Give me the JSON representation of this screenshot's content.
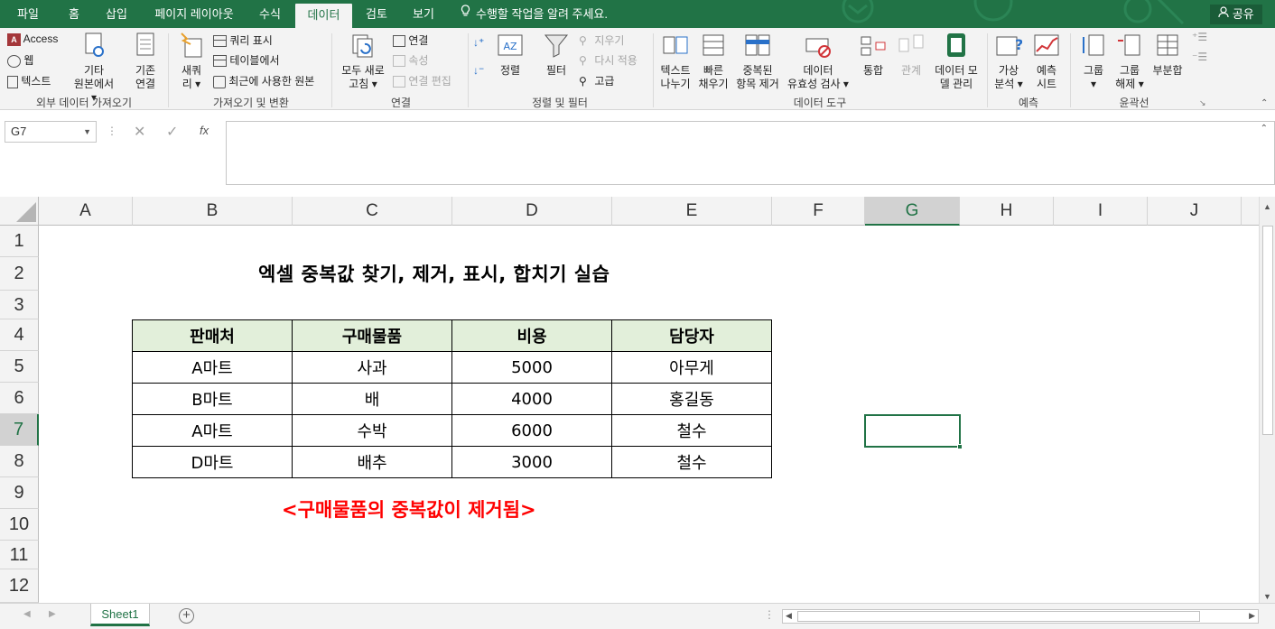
{
  "tabs": [
    "파일",
    "홈",
    "삽입",
    "페이지 레이아웃",
    "수식",
    "데이터",
    "검토",
    "보기"
  ],
  "active_tab": "데이터",
  "tell_me": "수행할 작업을 알려 주세요.",
  "share": "공유",
  "ribbon": {
    "ext_data": {
      "access": "Access",
      "web": "웹",
      "text": "텍스트",
      "other_line1": "기타",
      "other_line2": "원본에서",
      "existing_line1": "기존",
      "existing_line2": "연결",
      "label": "외부 데이터 가져오기"
    },
    "get_transform": {
      "new_query_line1": "새쿼",
      "new_query_line2": "리",
      "show_queries": "쿼리 표시",
      "from_table": "테이블에서",
      "recent_sources": "최근에 사용한 원본",
      "label": "가져오기 및 변환"
    },
    "connections": {
      "refresh_line1": "모두 새로",
      "refresh_line2": "고침",
      "connections": "연결",
      "properties": "속성",
      "edit_links": "연결 편집",
      "label": "연결"
    },
    "sort_filter": {
      "sort": "정렬",
      "filter": "필터",
      "clear": "지우기",
      "reapply": "다시 적용",
      "advanced": "고급",
      "label": "정렬 및 필터"
    },
    "data_tools": {
      "text_to_col_line1": "텍스트",
      "text_to_col_line2": "나누기",
      "flash_fill_line1": "빠른",
      "flash_fill_line2": "채우기",
      "remove_dup_line1": "중복된",
      "remove_dup_line2": "항목 제거",
      "validation_line1": "데이터",
      "validation_line2": "유효성 검사",
      "consolidate": "통합",
      "relationships": "관계",
      "data_model_line1": "데이터 모",
      "data_model_line2": "델 관리",
      "label": "데이터 도구"
    },
    "forecast": {
      "whatif_line1": "가상",
      "whatif_line2": "분석",
      "sheet_line1": "예측",
      "sheet_line2": "시트",
      "label": "예측"
    },
    "outline": {
      "group": "그룹",
      "ungroup_line1": "그룹",
      "ungroup_line2": "해제",
      "subtotal": "부분합",
      "label": "윤곽선"
    }
  },
  "name_box": "G7",
  "fx": "fx",
  "columns": [
    "A",
    "B",
    "C",
    "D",
    "E",
    "F",
    "G",
    "H",
    "I",
    "J"
  ],
  "rows": [
    "1",
    "2",
    "3",
    "4",
    "5",
    "6",
    "7",
    "8",
    "9",
    "10",
    "11",
    "12"
  ],
  "selected_column": "G",
  "selected_row": "7",
  "sheet_title": "엑셀 중복값 찾기, 제거, 표시, 합치기 실습",
  "table": {
    "headers": [
      "판매처",
      "구매물품",
      "비용",
      "담당자"
    ],
    "rows": [
      [
        "A마트",
        "사과",
        "5000",
        "아무게"
      ],
      [
        "B마트",
        "배",
        "4000",
        "홍길동"
      ],
      [
        "A마트",
        "수박",
        "6000",
        "철수"
      ],
      [
        "D마트",
        "배추",
        "3000",
        "철수"
      ]
    ]
  },
  "note": "<구매물품의 중복값이 제거됨>",
  "sheet_tab": "Sheet1",
  "colors": {
    "excel_green": "#217346",
    "header_fill": "#e2efda",
    "note_red": "#ff0000"
  }
}
